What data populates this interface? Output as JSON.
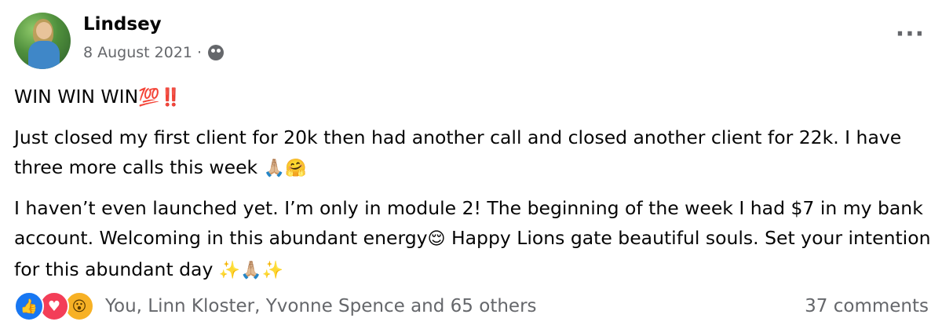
{
  "author": {
    "name": "Lindsey",
    "date": "8 August 2021",
    "separator": "·",
    "audience_icon": "friends-group-icon"
  },
  "post": {
    "line1_text": "WIN WIN WIN",
    "line1_emoji_100": "💯",
    "line1_emoji_bang": "‼️",
    "para2": "Just closed my first client for 20k then had another call and closed another client for 22k. I have three more calls this week",
    "para2_emoji": "🙏🏼🤗",
    "para3": "I haven’t even launched yet. I’m only in module 2! The beginning of the week I had $7 in my bank account. Welcoming in this abundant energy",
    "para3_emoji1": "😌",
    "para3_cont": " Happy Lions gate beautiful souls. Set your intention for this abundant day ",
    "para3_emoji2": "✨🙏🏼✨"
  },
  "footer": {
    "reaction_icons": [
      "like-icon",
      "love-icon",
      "wow-icon"
    ],
    "reactors": "You, Linn Kloster, Yvonne Spence and 65 others",
    "comments": "37 comments"
  },
  "menu": {
    "more_label": "···"
  },
  "colors": {
    "like": "#1877f2",
    "love": "#f33e58",
    "wow": "#f7b125",
    "meta_text": "#65676b"
  }
}
